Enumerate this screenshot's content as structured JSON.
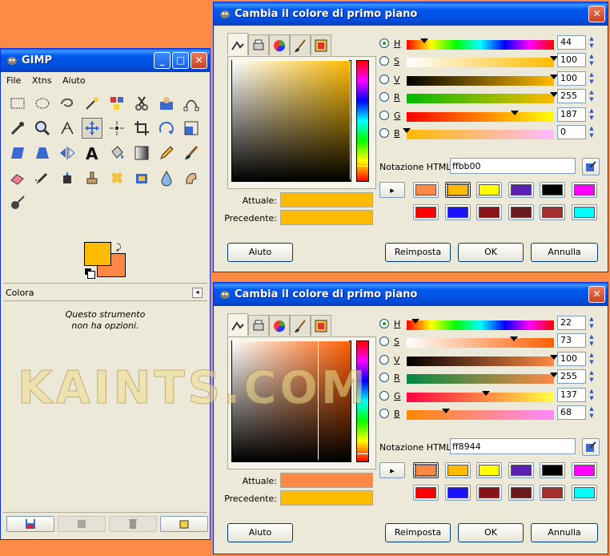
{
  "gimp": {
    "title": "GIMP",
    "menu": [
      "File",
      "Xtns",
      "Aiuto"
    ],
    "tools": [
      "rect-select-icon",
      "ellipse-select-icon",
      "lasso-icon",
      "fuzzy-select-icon",
      "select-by-color-icon",
      "scissors-icon",
      "foreground-select-icon",
      "paths-icon",
      "color-picker-icon",
      "zoom-icon",
      "measure-icon",
      "move-icon",
      "align-icon",
      "crop-icon",
      "rotate-icon",
      "scale-icon",
      "shear-icon",
      "perspective-icon",
      "flip-icon",
      "text-icon",
      "bucket-fill-icon",
      "blend-icon",
      "pencil-icon",
      "paintbrush-icon",
      "eraser-icon",
      "airbrush-icon",
      "ink-icon",
      "clone-icon",
      "heal-icon",
      "perspective-clone-icon",
      "blur-icon",
      "smudge-icon",
      "dodge-burn-icon"
    ],
    "fg_color": "#ffbb00",
    "bg_color": "#ff8944",
    "options_title": "Colora",
    "options_msg_1": "Questo strumento",
    "options_msg_2": "non ha opzioni."
  },
  "dialogs": [
    {
      "title": "Cambia il colore di primo piano",
      "channels": [
        {
          "key": "H",
          "value": "44"
        },
        {
          "key": "S",
          "value": "100"
        },
        {
          "key": "V",
          "value": "100"
        },
        {
          "key": "R",
          "value": "255"
        },
        {
          "key": "G",
          "value": "187"
        },
        {
          "key": "B",
          "value": "0"
        }
      ],
      "html_label": "Notazione HTML:",
      "html_value": "ffbb00",
      "current_label": "Attuale:",
      "previous_label": "Precedente:",
      "current_color": "#ffbb00",
      "previous_color": "#ffbb00",
      "history": [
        "#ff8944",
        "#ffbb00",
        "#ffff00",
        "#5a1fb4",
        "#000000",
        "#ff00ff",
        "#ff0000",
        "#1a10ff",
        "#8a1218",
        "#6a1a1a",
        "#a43030",
        "#00ffff"
      ],
      "buttons": {
        "help": "Aiuto",
        "reset": "Reimposta",
        "ok": "OK",
        "cancel": "Annulla"
      }
    },
    {
      "title": "Cambia il colore di primo piano",
      "channels": [
        {
          "key": "H",
          "value": "22"
        },
        {
          "key": "S",
          "value": "73"
        },
        {
          "key": "V",
          "value": "100"
        },
        {
          "key": "R",
          "value": "255"
        },
        {
          "key": "G",
          "value": "137"
        },
        {
          "key": "B",
          "value": "68"
        }
      ],
      "html_label": "Notazione HTML:",
      "html_value": "ff8944",
      "current_label": "Attuale:",
      "previous_label": "Precedente:",
      "current_color": "#ff8944",
      "previous_color": "#ffbb00",
      "history": [
        "#ff8944",
        "#ffbb00",
        "#ffff00",
        "#5a1fb4",
        "#000000",
        "#ff00ff",
        "#ff0000",
        "#1a10ff",
        "#8a1218",
        "#6a1a1a",
        "#a43030",
        "#00ffff"
      ],
      "buttons": {
        "help": "Aiuto",
        "reset": "Reimposta",
        "ok": "OK",
        "cancel": "Annulla"
      }
    }
  ],
  "watermark": "KAINTS.COM"
}
